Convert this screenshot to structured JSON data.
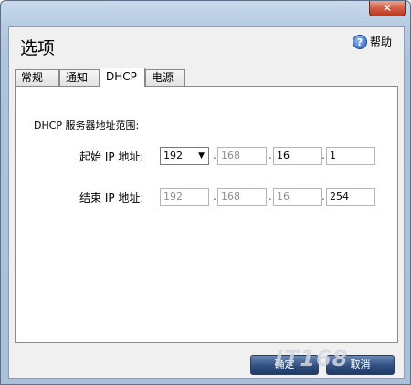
{
  "window": {
    "title": "选项",
    "close_label": "✕",
    "help_label": "帮助",
    "help_icon_glyph": "?"
  },
  "tabs": [
    {
      "label": "常规",
      "active": false
    },
    {
      "label": "通知",
      "active": false
    },
    {
      "label": "DHCP",
      "active": true
    },
    {
      "label": "电源",
      "active": false
    }
  ],
  "dhcp": {
    "section_label": "DHCP 服务器地址范围:",
    "start": {
      "label": "起始 IP 地址:",
      "octets": [
        "192",
        "168",
        "16",
        "1"
      ]
    },
    "end": {
      "label": "结束 IP 地址:",
      "octets": [
        "192",
        "168",
        "16",
        "254"
      ]
    },
    "select_arrow": "▼",
    "dot": "."
  },
  "footer": {
    "ok_label": "确定",
    "cancel_label": "取消"
  },
  "watermark": "IT168",
  "colors": {
    "accent_button": "#2f4f80",
    "close_button": "#d2583d",
    "disabled_text": "#8e8e8e"
  }
}
